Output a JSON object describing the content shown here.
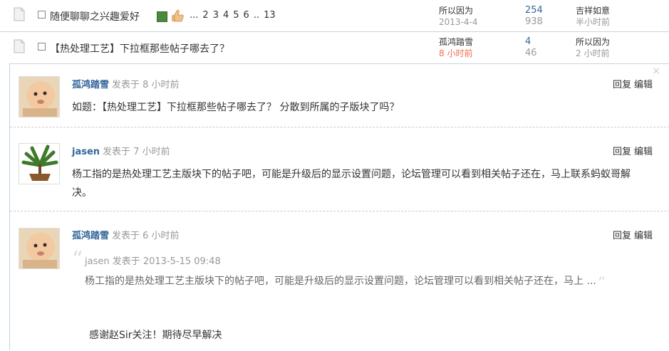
{
  "thread_list": [
    {
      "title": "随便聊聊之兴趣爱好",
      "pages": [
        "...",
        "2",
        "3",
        "4",
        "5",
        "6",
        "..",
        "13"
      ],
      "author": "所以因为",
      "date": "2013-4-4",
      "replies": "254",
      "views": "938",
      "last_poster": "吉祥如意",
      "last_time": "半小时前"
    },
    {
      "title": "【热处理工艺】下拉框那些帖子哪去了？",
      "author": "孤鸿踏雪",
      "date": "8 小时前",
      "replies": "4",
      "views": "46",
      "last_poster": "所以因为",
      "last_time": "2 小时前"
    }
  ],
  "panel": {
    "close": "×",
    "posts": [
      {
        "author": "孤鸿踏雪",
        "posted": "发表于 8 小时前",
        "reply": "回复",
        "edit": "编辑",
        "content": "如题：【热处理工艺】下拉框那些帖子哪去了？ 分散到所属的子版块了吗？"
      },
      {
        "author": "jasen",
        "posted": "发表于 7 小时前",
        "reply": "回复",
        "edit": "编辑",
        "content": "杨工指的是热处理工艺主版块下的帖子吧，可能是升级后的显示设置问题，论坛管理可以看到相关帖子还在，马上联系蚂蚁哥解决。"
      },
      {
        "author": "孤鸿踏雪",
        "posted": "发表于 6 小时前",
        "reply": "回复",
        "edit": "编辑",
        "quote_meta": "jasen 发表于 2013-5-15 09:48",
        "quote_text": "杨工指的是热处理工艺主版块下的帖子吧，可能是升级后的显示设置问题，论坛管理可以看到相关帖子还在，马上 ...",
        "content": "感谢赵Sir关注！期待尽早解决"
      }
    ]
  },
  "colors": {
    "link_blue": "#336699",
    "new_red": "#f26c4f",
    "border": "#c2d5e3"
  }
}
